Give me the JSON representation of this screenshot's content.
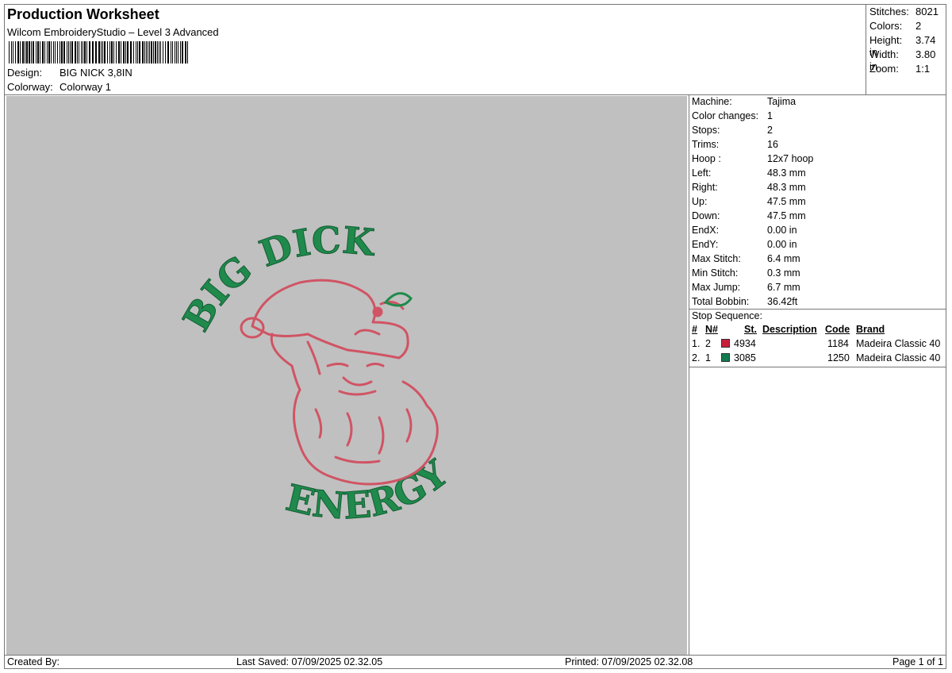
{
  "header": {
    "title": "Production Worksheet",
    "software": "Wilcom EmbroideryStudio – Level 3 Advanced",
    "design_label": "Design:",
    "design_value": "BIG NICK 3,8IN",
    "colorway_label": "Colorway:",
    "colorway_value": "Colorway 1"
  },
  "summary": {
    "stitches_label": "Stitches:",
    "stitches_value": "8021",
    "colors_label": "Colors:",
    "colors_value": "2",
    "height_label": "Height:",
    "height_value": "3.74 in",
    "width_label": "Width:",
    "width_value": "3.80 in",
    "zoom_label": "Zoom:",
    "zoom_value": "1:1"
  },
  "preview": {
    "top_text": "BIG DICK",
    "bottom_text": "ENERGY",
    "thread_red": "#d05464",
    "thread_green": "#1f8a4c",
    "background": "#c0c0c0"
  },
  "machine_info": [
    {
      "label": "Machine:",
      "value": "Tajima"
    },
    {
      "label": "Color changes:",
      "value": "1"
    },
    {
      "label": "Stops:",
      "value": "2"
    },
    {
      "label": "Trims:",
      "value": "16"
    },
    {
      "label": "Hoop :",
      "value": "12x7 hoop"
    },
    {
      "label": "Left:",
      "value": "48.3 mm"
    },
    {
      "label": "Right:",
      "value": "48.3 mm"
    },
    {
      "label": "Up:",
      "value": "47.5 mm"
    },
    {
      "label": "Down:",
      "value": "47.5 mm"
    },
    {
      "label": "EndX:",
      "value": "0.00 in"
    },
    {
      "label": "EndY:",
      "value": "0.00 in"
    },
    {
      "label": "Max Stitch:",
      "value": "6.4 mm"
    },
    {
      "label": "Min Stitch:",
      "value": "0.3 mm"
    },
    {
      "label": "Max Jump:",
      "value": "6.7 mm"
    },
    {
      "label": "Total Bobbin:",
      "value": "36.42ft"
    }
  ],
  "stop_sequence": {
    "title": "Stop Sequence:",
    "headers": {
      "num": "#",
      "n": "N#",
      "st": "St.",
      "description": "Description",
      "code": "Code",
      "brand": "Brand"
    },
    "rows": [
      {
        "num": "1.",
        "n": "2",
        "swatch": "#c8203c",
        "st": "4934",
        "description": "",
        "code": "1184",
        "brand": "Madeira Classic 40"
      },
      {
        "num": "2.",
        "n": "1",
        "swatch": "#137a4e",
        "st": "3085",
        "description": "",
        "code": "1250",
        "brand": "Madeira Classic 40"
      }
    ]
  },
  "footer": {
    "created_by": "Created By:",
    "last_saved": "Last Saved: 07/09/2025 02.32.05",
    "printed": "Printed: 07/09/2025 02.32.08",
    "page": "Page 1 of 1"
  }
}
